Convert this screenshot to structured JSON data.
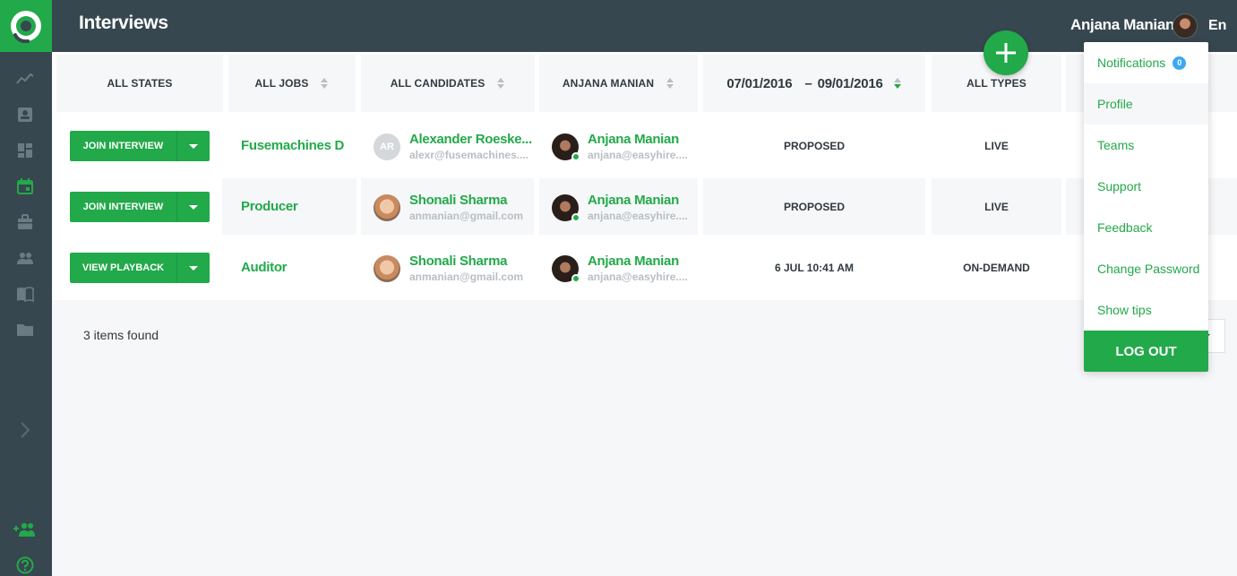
{
  "header": {
    "title": "Interviews",
    "user_name": "Anjana Manian",
    "language": "En"
  },
  "sidebar": {
    "icons": [
      "analytics-icon",
      "contact-card-icon",
      "dashboard-icon",
      "calendar-icon",
      "briefcase-icon",
      "people-icon",
      "book-icon",
      "folder-icon",
      "chevron-right-icon",
      "add-people-icon",
      "help-icon"
    ],
    "active": "calendar-icon"
  },
  "filters": {
    "states": "ALL STATES",
    "jobs": "ALL JOBS",
    "candidates": "ALL CANDIDATES",
    "interviewer": "ANJANA MANIAN",
    "date_from": "07/01/2016",
    "date_sep": "–",
    "date_to": "09/01/2016",
    "types": "ALL TYPES"
  },
  "rows": [
    {
      "action": "JOIN INTERVIEW",
      "job": "Fusemachines D...",
      "candidate": {
        "initials": "AR",
        "name": "Alexander Roeske...",
        "email": "alexr@fusemachines...."
      },
      "interviewer": {
        "name": "Anjana Manian",
        "email": "anjana@easyhire...."
      },
      "status": "PROPOSED",
      "type": "LIVE"
    },
    {
      "action": "JOIN INTERVIEW",
      "job": "Producer",
      "candidate": {
        "initials": "",
        "name": "Shonali Sharma",
        "email": "anmanian@gmail.com"
      },
      "interviewer": {
        "name": "Anjana Manian",
        "email": "anjana@easyhire...."
      },
      "status": "PROPOSED",
      "type": "LIVE"
    },
    {
      "action": "VIEW PLAYBACK",
      "job": "Auditor",
      "candidate": {
        "initials": "",
        "name": "Shonali Sharma",
        "email": "anmanian@gmail.com"
      },
      "interviewer": {
        "name": "Anjana Manian",
        "email": "anjana@easyhire...."
      },
      "status": "6 JUL 10:41 AM",
      "type": "ON-DEMAND"
    }
  ],
  "footer": {
    "items_found": "3 items found"
  },
  "user_menu": {
    "notifications_label": "Notifications",
    "notifications_count": "0",
    "items": [
      "Profile",
      "Teams",
      "Support",
      "Feedback",
      "Change Password",
      "Show tips"
    ],
    "logout": "LOG OUT"
  },
  "colors": {
    "brand_green": "#22a94a",
    "dark_bar": "#37474f",
    "badge_blue": "#3ea8f0"
  }
}
